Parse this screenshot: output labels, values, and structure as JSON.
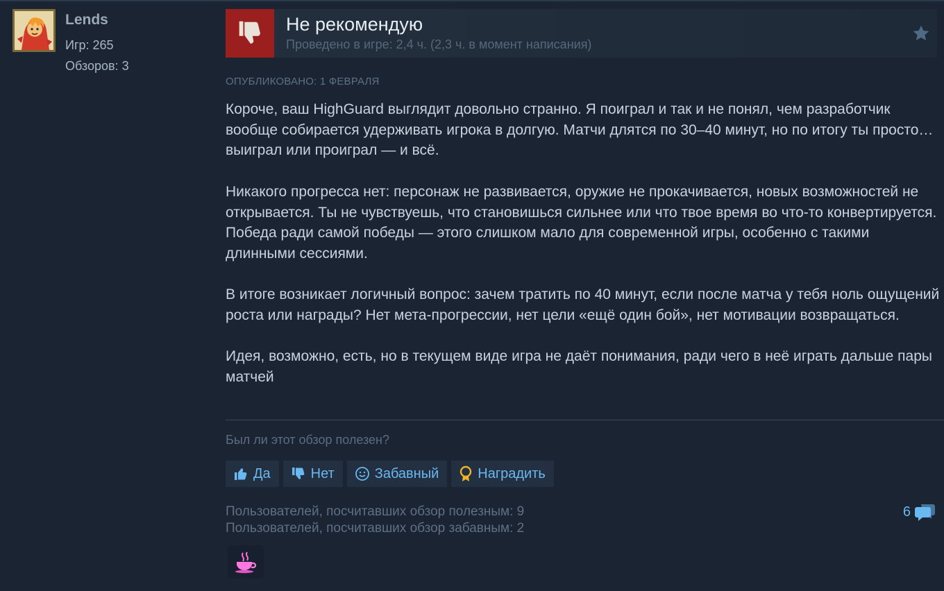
{
  "author": {
    "name": "Lends",
    "games": "Игр: 265",
    "reviews": "Обзоров: 3"
  },
  "review": {
    "verdict": "Не рекомендую",
    "hours": "Проведено в игре: 2,4 ч. (2,3 ч. в момент написания)",
    "posted": "ОПУБЛИКОВАНО: 1 ФЕВРАЛЯ",
    "paragraphs": [
      "Короче, ваш HighGuard выглядит довольно странно. Я поиграл и так и не понял, чем разработчик вообще собирается удерживать игрока в долгую. Матчи длятся по 30–40 минут, но по итогу ты просто… выиграл или проиграл — и всё.",
      "Никакого прогресса нет: персонаж не развивается, оружие не прокачивается, новых возможностей не открывается. Ты не чувствуешь, что становишься сильнее или что твое время во что-то конвертируется. Победа ради самой победы — этого слишком мало для современной игры, особенно с такими длинными сессиями.",
      "В итоге возникает логичный вопрос: зачем тратить по 40 минут, если после матча у тебя ноль ощущений роста или награды? Нет мета-прогрессии, нет цели «ещё один бой», нет мотивации возвращаться.",
      "Идея, возможно, есть, но в текущем виде игра не даёт понимания, ради чего в неё играть дальше пары матчей"
    ]
  },
  "feedback": {
    "question": "Был ли этот обзор полезен?",
    "yes_label": "Да",
    "no_label": "Нет",
    "funny_label": "Забавный",
    "award_label": "Наградить",
    "helpful_count_text": "Пользователей, посчитавших обзор полезным: 9",
    "funny_count_text": "Пользователей, посчитавших обзор забавным: 2",
    "comment_count": "6"
  },
  "colors": {
    "background": "#1a2432",
    "accent": "#6ab8f0",
    "not_recommended": "#9c1f1f"
  },
  "icons": {
    "verdict": "thumbs-down-icon",
    "star": "star-icon",
    "yes": "thumbs-up-icon",
    "no": "thumbs-down-icon",
    "funny": "smiley-icon",
    "award": "award-medal-icon",
    "comments": "speech-bubble-icon",
    "award_received": "teacup-icon"
  }
}
